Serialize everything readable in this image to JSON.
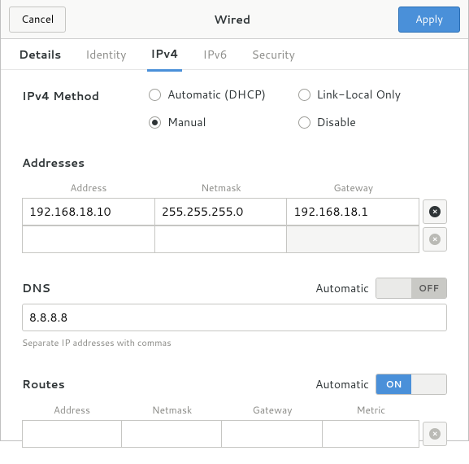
{
  "header": {
    "cancel": "Cancel",
    "title": "Wired",
    "apply": "Apply"
  },
  "tabs": {
    "details": "Details",
    "identity": "Identity",
    "ipv4": "IPv4",
    "ipv6": "IPv6",
    "security": "Security"
  },
  "method": {
    "label": "IPv4 Method",
    "automatic": "Automatic (DHCP)",
    "manual": "Manual",
    "link_local": "Link-Local Only",
    "disable": "Disable",
    "selected": "manual"
  },
  "addresses": {
    "title": "Addresses",
    "cols": {
      "address": "Address",
      "netmask": "Netmask",
      "gateway": "Gateway"
    },
    "rows": [
      {
        "address": "192.168.18.10",
        "netmask": "255.255.255.0",
        "gateway": "192.168.18.1"
      },
      {
        "address": "",
        "netmask": "",
        "gateway": ""
      }
    ]
  },
  "dns": {
    "title": "DNS",
    "automatic_label": "Automatic",
    "automatic_on": false,
    "off_text": "OFF",
    "on_text": "ON",
    "value": "8.8.8.8",
    "hint": "Separate IP addresses with commas"
  },
  "routes": {
    "title": "Routes",
    "automatic_label": "Automatic",
    "automatic_on": true,
    "off_text": "OFF",
    "on_text": "ON",
    "cols": {
      "address": "Address",
      "netmask": "Netmask",
      "gateway": "Gateway",
      "metric": "Metric"
    },
    "rows": [
      {
        "address": "",
        "netmask": "",
        "gateway": "",
        "metric": ""
      }
    ]
  }
}
